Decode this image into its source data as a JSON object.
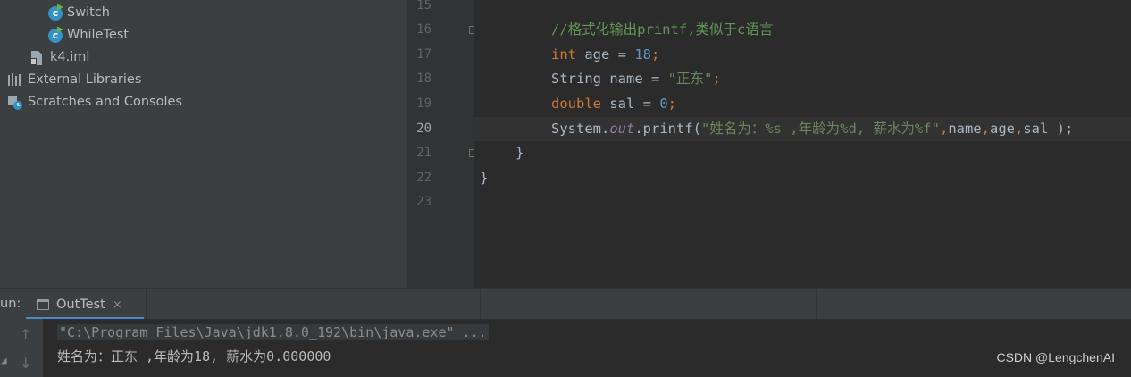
{
  "project_tree": {
    "items": [
      {
        "label": "Switch",
        "icon": "java-class-icon"
      },
      {
        "label": "WhileTest",
        "icon": "java-class-icon"
      },
      {
        "label": "k4.iml",
        "icon": "module-file-icon"
      },
      {
        "label": "External Libraries",
        "icon": "libraries-icon"
      },
      {
        "label": "Scratches and Consoles",
        "icon": "scratches-icon"
      }
    ]
  },
  "editor": {
    "line_numbers": [
      "15",
      "16",
      "17",
      "18",
      "19",
      "20",
      "21",
      "22",
      "23"
    ],
    "current_line": "20",
    "lines": {
      "comment": "//格式化输出printf,类似于c语言",
      "l17_kw": "int",
      "l17_rest": " age = ",
      "l17_num": "18",
      "l17_end": ";",
      "l18_rest": "String name = ",
      "l18_str": "\"正东\"",
      "l18_end": ";",
      "l19_kw": "double",
      "l19_rest": " sal = ",
      "l19_num": "0",
      "l19_end": ";",
      "l20_a": "System.",
      "l20_field": "out",
      "l20_b": ".printf(",
      "l20_str": "\"姓名为：%s ,年龄为%d, 薪水为%f\"",
      "l20_c1": ",",
      "l20_name": "name",
      "l20_c2": ",",
      "l20_age": "age",
      "l20_c3": ",",
      "l20_sal": "sal ",
      "l20_end": ");",
      "l21": "}",
      "l22": "}"
    }
  },
  "run_panel": {
    "label": "un:",
    "tab_label": "OutTest",
    "tab_close": "×",
    "console_command": "\"C:\\Program Files\\Java\\jdk1.8.0_192\\bin\\java.exe\" ...",
    "console_output": "姓名为：正东 ,年龄为18, 薪水为0.000000"
  },
  "watermark": "CSDN @LengchenAI",
  "colors": {
    "keyword": "#cc7832",
    "number": "#6897bb",
    "string": "#6a8759",
    "comment": "#629755",
    "field": "#9876aa",
    "accent": "#4a88c7"
  }
}
